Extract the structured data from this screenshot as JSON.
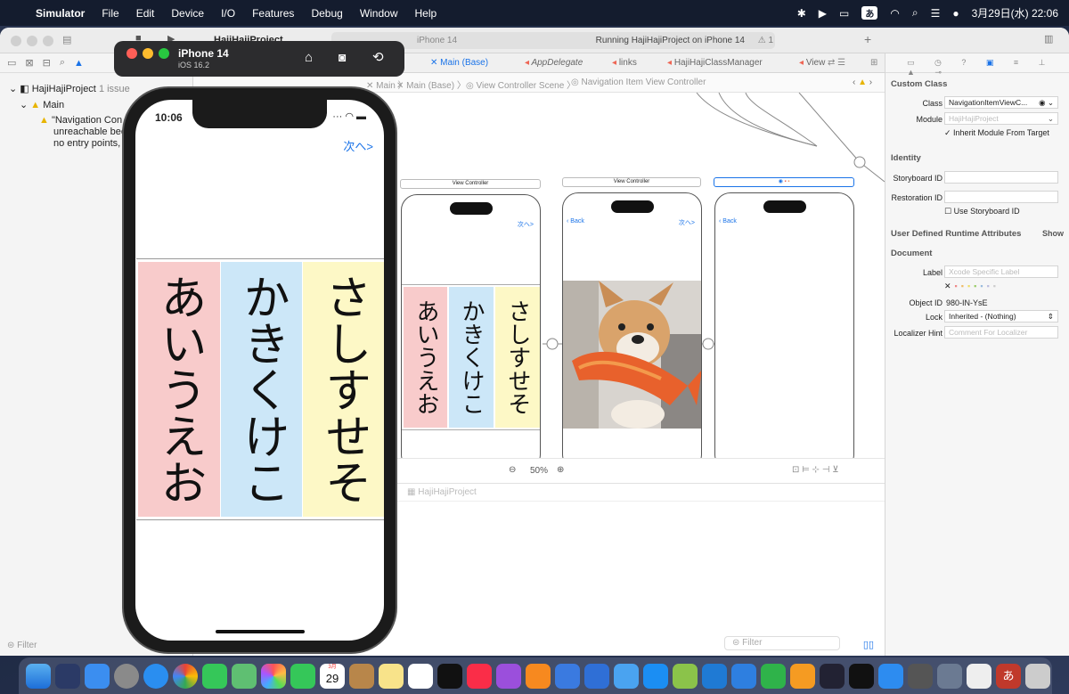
{
  "menubar": {
    "app": "Simulator",
    "items": [
      "File",
      "Edit",
      "Device",
      "I/O",
      "Features",
      "Debug",
      "Window",
      "Help"
    ],
    "ime": "あ",
    "clock": "3月29日(水) 22:06"
  },
  "toolbar": {
    "project": "HajiHajiProject",
    "scheme_device": "iPhone 14",
    "status": "Running HajiHajiProject on iPhone 14",
    "warning_count": "1"
  },
  "navigator": {
    "project": "HajiHajiProject",
    "issue_count": "1 issue",
    "group": "Main",
    "issue_lines": [
      "\"Navigation Con",
      "unreachable bec",
      "no entry points,"
    ],
    "filter_placeholder": "Filter"
  },
  "tabs": [
    "Main (Base)",
    "AppDelegate",
    "links",
    "HajiHajiClassManager",
    "View"
  ],
  "jumpbar": [
    "Main",
    "Main (Base)",
    "View Controller Scene",
    "Navigation Item View Controller"
  ],
  "canvas": {
    "scene1_title": "View Controller",
    "scene2_title": "View Controller",
    "next_label": "次へ>",
    "back_label": "Back",
    "zoom": "50%",
    "debug_target": "HajiHajiProject",
    "debug_filter": "Filter"
  },
  "kana": {
    "col1": "あいうえお",
    "col2": "かきくけこ",
    "col3": "さしすせそ",
    "col1_color": "#f8cbcb",
    "col2_color": "#cce7f8",
    "col3_color": "#fdf8c6"
  },
  "inspector": {
    "custom_class": "Custom Class",
    "class_label": "Class",
    "class_value": "NavigationItemViewC...",
    "module_label": "Module",
    "module_value": "HajiHajiProject",
    "inherit": "Inherit Module From Target",
    "identity": "Identity",
    "storyboard_id": "Storyboard ID",
    "restoration_id": "Restoration ID",
    "use_storyboard_id": "Use Storyboard ID",
    "runtime_attrs": "User Defined Runtime Attributes",
    "show": "Show",
    "document": "Document",
    "label_label": "Label",
    "label_placeholder": "Xcode Specific Label",
    "object_id_label": "Object ID",
    "object_id": "980-IN-YsE",
    "lock_label": "Lock",
    "lock_value": "Inherited - (Nothing)",
    "localizer_label": "Localizer Hint",
    "localizer_placeholder": "Comment For Localizer"
  },
  "simulator": {
    "device": "iPhone 14",
    "os": "iOS 16.2",
    "time": "10:06",
    "next_label": "次へ>"
  },
  "dock": {
    "calendar_day": "29",
    "calendar_month": "3月"
  }
}
